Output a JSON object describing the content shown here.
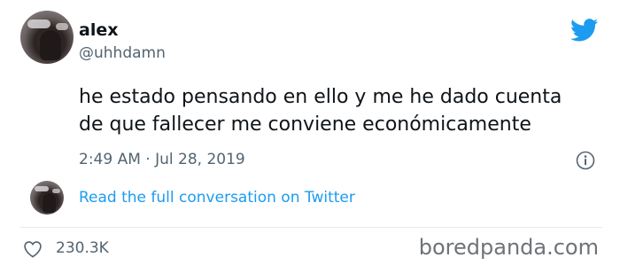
{
  "user": {
    "name": "alex",
    "handle": "@uhhdamn"
  },
  "tweet": {
    "text_line1": "he estado pensando en ello y me he dado cuenta",
    "text_line2": "de que fallecer me conviene económicamente",
    "timestamp": "2:49 AM · Jul 28, 2019"
  },
  "conversation_link": "Read the full conversation on Twitter",
  "likes": "230.3K",
  "watermark": "boredpanda.com",
  "icons": {
    "brand": "twitter-bird-icon",
    "info": "info-icon",
    "like": "heart-icon"
  },
  "colors": {
    "accent": "#1d9bf0",
    "text": "#0f1419",
    "muted": "#536471"
  }
}
